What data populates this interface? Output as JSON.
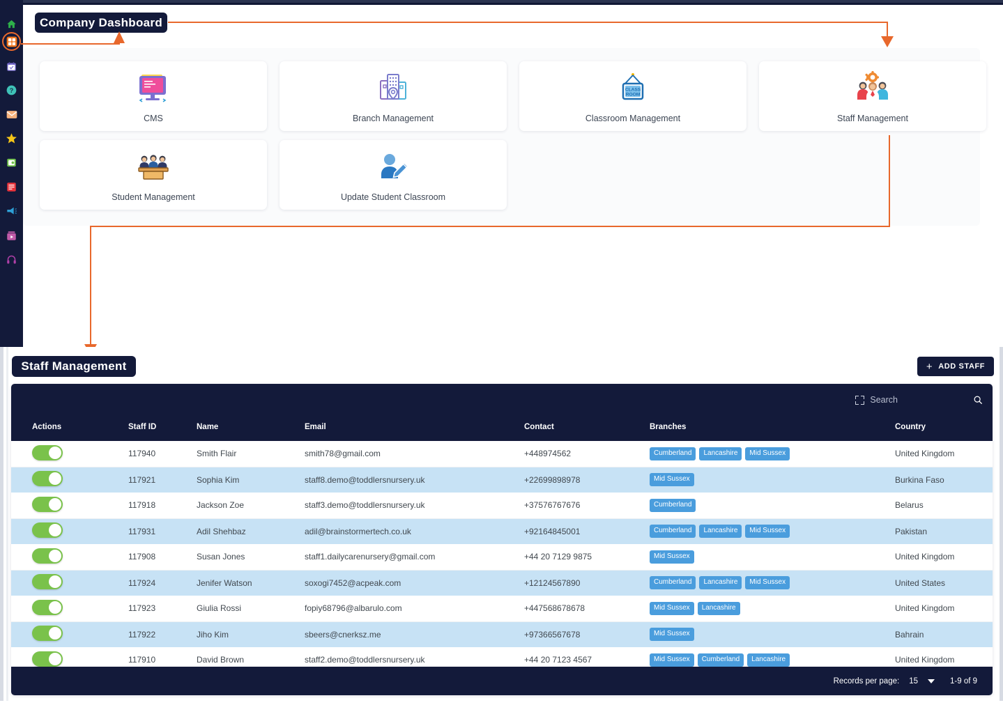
{
  "dashboard": {
    "title": "Company Dashboard",
    "cards": [
      {
        "label": "CMS",
        "icon": "cms-monitor-icon"
      },
      {
        "label": "Branch Management",
        "icon": "branch-buildings-icon"
      },
      {
        "label": "Classroom Management",
        "icon": "classroom-sign-icon"
      },
      {
        "label": "Staff Management",
        "icon": "staff-people-gear-icon"
      },
      {
        "label": "Student Management",
        "icon": "student-desk-icon"
      },
      {
        "label": "Update Student Classroom",
        "icon": "update-student-pencil-icon"
      }
    ]
  },
  "sidebar": {
    "items": [
      {
        "name": "home-icon",
        "glyph": "⌂",
        "color": "#2eb04a"
      },
      {
        "name": "dashboard-grid-icon",
        "glyph": "▦",
        "color": "#f07820"
      },
      {
        "name": "calendar-check-icon",
        "glyph": "Ὄ5",
        "color": "#7b6fd0"
      },
      {
        "name": "help-question-icon",
        "glyph": "?",
        "color": "#3fc2b8"
      },
      {
        "name": "mail-envelope-icon",
        "glyph": "✉",
        "color": "#f0a070"
      },
      {
        "name": "star-icon",
        "glyph": "★",
        "color": "#f5c518"
      },
      {
        "name": "wallet-icon",
        "glyph": "■",
        "color": "#6fc04a"
      },
      {
        "name": "document-list-icon",
        "glyph": "▤",
        "color": "#e8343c"
      },
      {
        "name": "megaphone-icon",
        "glyph": "◀",
        "color": "#2e9fd6"
      },
      {
        "name": "media-player-icon",
        "glyph": "▶",
        "color": "#c05aa8"
      },
      {
        "name": "headset-support-icon",
        "glyph": "♫",
        "color": "#b040a8"
      }
    ]
  },
  "staff": {
    "title": "Staff Management",
    "add_button": "ADD STAFF",
    "add_button_plus": "+",
    "search_placeholder": "Search",
    "columns": [
      "Actions",
      "Staff ID",
      "Name",
      "Email",
      "Contact",
      "Branches",
      "Country"
    ],
    "rows": [
      {
        "staff_id": "117940",
        "name": "Smith Flair",
        "email": "smith78@gmail.com",
        "contact": "+448974562",
        "branches": [
          "Cumberland",
          "Lancashire",
          "Mid Sussex"
        ],
        "country": "United Kingdom",
        "enabled": true
      },
      {
        "staff_id": "117921",
        "name": "Sophia Kim",
        "email": "staff8.demo@toddlersnursery.uk",
        "contact": "+22699898978",
        "branches": [
          "Mid Sussex"
        ],
        "country": "Burkina Faso",
        "enabled": true
      },
      {
        "staff_id": "117918",
        "name": "Jackson Zoe",
        "email": "staff3.demo@toddlersnursery.uk",
        "contact": "+37576767676",
        "branches": [
          "Cumberland"
        ],
        "country": "Belarus",
        "enabled": true
      },
      {
        "staff_id": "117931",
        "name": "Adil Shehbaz",
        "email": "adil@brainstormertech.co.uk",
        "contact": "+92164845001",
        "branches": [
          "Cumberland",
          "Lancashire",
          "Mid Sussex"
        ],
        "country": "Pakistan",
        "enabled": true
      },
      {
        "staff_id": "117908",
        "name": "Susan Jones",
        "email": "staff1.dailycarenursery@gmail.com",
        "contact": "+44 20 7129 9875",
        "branches": [
          "Mid Sussex"
        ],
        "country": "United Kingdom",
        "enabled": true
      },
      {
        "staff_id": "117924",
        "name": "Jenifer Watson",
        "email": "soxogi7452@acpeak.com",
        "contact": "+12124567890",
        "branches": [
          "Cumberland",
          "Lancashire",
          "Mid Sussex"
        ],
        "country": "United States",
        "enabled": true
      },
      {
        "staff_id": "117923",
        "name": "Giulia Rossi",
        "email": "fopiy68796@albarulo.com",
        "contact": "+447568678678",
        "branches": [
          "Mid Sussex",
          "Lancashire"
        ],
        "country": "United Kingdom",
        "enabled": true
      },
      {
        "staff_id": "117922",
        "name": "Jiho Kim",
        "email": "sbeers@cnerksz.me",
        "contact": "+97366567678",
        "branches": [
          "Mid Sussex"
        ],
        "country": "Bahrain",
        "enabled": true
      },
      {
        "staff_id": "117910",
        "name": "David Brown",
        "email": "staff2.demo@toddlersnursery.uk",
        "contact": "+44 20 7123 4567",
        "branches": [
          "Mid Sussex",
          "Cumberland",
          "Lancashire"
        ],
        "country": "United Kingdom",
        "enabled": true
      }
    ],
    "footer": {
      "records_per_page_label": "Records per page:",
      "records_per_page_value": "15",
      "range": "1-9 of 9"
    }
  },
  "colors": {
    "navy": "#131a3a",
    "accent_orange": "#e8682c",
    "badge_blue": "#4a9ddd",
    "toggle_green": "#7ac24b",
    "row_alt": "#c7e2f5"
  }
}
